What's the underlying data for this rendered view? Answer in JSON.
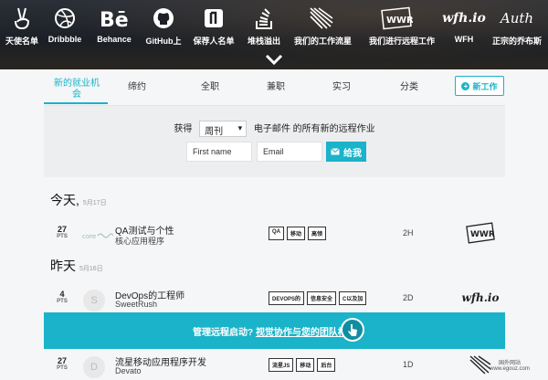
{
  "nav": [
    {
      "label": "天使名单",
      "icon": "angellist-icon"
    },
    {
      "label": "Dribbble",
      "icon": "dribbble-icon"
    },
    {
      "label": "Behance",
      "icon": "behance-icon"
    },
    {
      "label": "GitHub上",
      "icon": "github-icon"
    },
    {
      "label": "保荐人名单",
      "icon": "producthunt-icon"
    },
    {
      "label": "堆栈溢出",
      "icon": "stackoverflow-icon"
    },
    {
      "label": "我们的工作流星",
      "icon": "meteor-icon"
    },
    {
      "label": "我们进行远程工作",
      "icon": "wwr-icon"
    },
    {
      "label": "WFH",
      "icon": "wfh-icon",
      "logo_text": "wfh.io"
    },
    {
      "label": "正宗的乔布斯",
      "icon": "authentic-jobs-icon",
      "logo_text": "Auth"
    }
  ],
  "tabs": [
    "新的就业机会",
    "缔约",
    "全职",
    "兼职",
    "实习",
    "分类"
  ],
  "new_job_label": "新工作",
  "subscribe": {
    "prefix": "获得",
    "frequency": "周刊",
    "suffix": "电子邮件 的所有新的远程作业",
    "first_name_placeholder": "First name",
    "email_placeholder": "Email",
    "button": "给我"
  },
  "days": [
    {
      "label": "今天,",
      "date": "5月17日"
    },
    {
      "label": "昨天",
      "date": "5月16日"
    }
  ],
  "jobs": [
    {
      "points": "27",
      "pts_unit": "PTS",
      "title": "QA测试与个性",
      "company": "核心应用程序",
      "tags": [
        "QA",
        "移动",
        "高领"
      ],
      "age": "2H",
      "source": "WWR",
      "logo": "coreapps"
    },
    {
      "points": "4",
      "pts_unit": "PTS",
      "title": "DevOps的工程师",
      "company": "SweetRush",
      "tags": [
        "DEVOPS的",
        "信息安全",
        "C以及加"
      ],
      "age": "2D",
      "source": "wfh.io",
      "logo": "S"
    },
    {
      "points": "27",
      "pts_unit": "PTS",
      "title": "流星移动应用程序开发",
      "company": "Devato",
      "tags": [
        "流星JS",
        "移动",
        "后台"
      ],
      "age": "1D",
      "source": "meteor",
      "logo": "D"
    }
  ],
  "banner": {
    "text": "管理远程启动?",
    "link": "视觉协作与您的团队构建"
  },
  "watermark": {
    "line1": "国外网站",
    "line2": "www.egouz.com"
  },
  "colors": {
    "accent": "#1ab3c9",
    "header": "#1d2127"
  }
}
